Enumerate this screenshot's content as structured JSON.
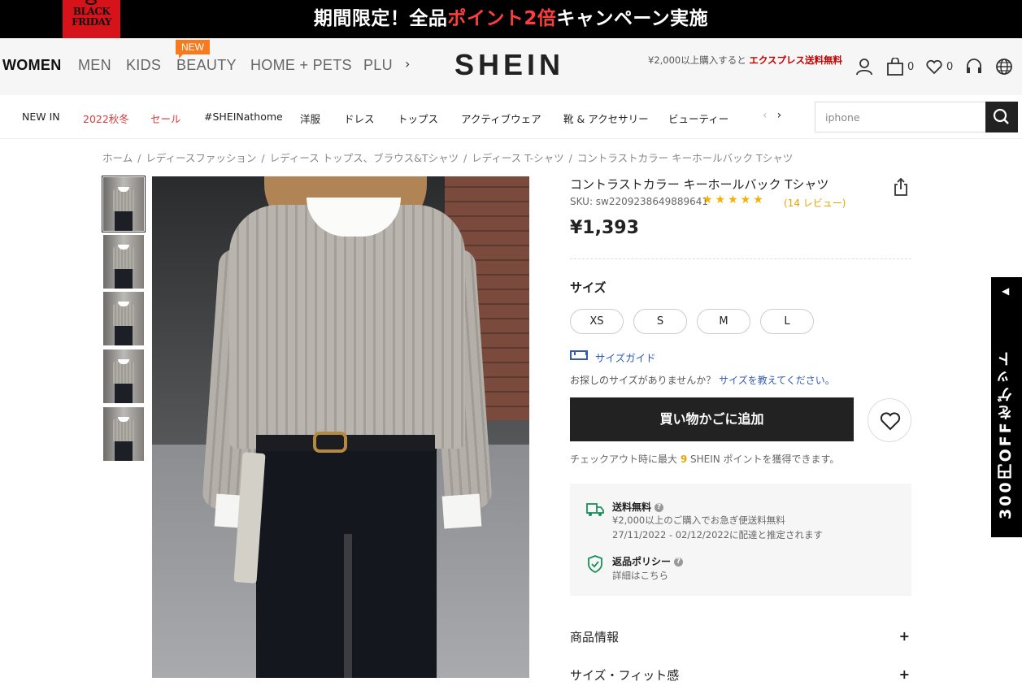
{
  "promo": {
    "badge_line1": "BLACK",
    "badge_line2": "FRIDAY",
    "text_before": "期間限定！全品",
    "text_highlight": "ポイント2倍",
    "text_after": "キャンペーン実施"
  },
  "header": {
    "categories": [
      "WOMEN",
      "MEN",
      "KIDS",
      "BEAUTY",
      "HOME + PETS",
      "PLU"
    ],
    "new_badge": "NEW",
    "logo": "SHEIN",
    "shipping_note_plain": "¥2,000以上購入すると ",
    "shipping_note_red": "エクスプレス送料無料",
    "bag_count": "0",
    "wishlist_count": "0"
  },
  "subnav": {
    "items": [
      "NEW IN",
      "2022秋冬",
      "セール",
      "#SHEINathome",
      "洋服",
      "ドレス",
      "トップス",
      "アクティブウェア",
      "靴 & アクセサリー",
      "ビューティー"
    ],
    "search_placeholder": "iphone"
  },
  "breadcrumb": [
    "ホーム",
    "レディースファッション",
    "レディース トップス、ブラウス&Tシャツ",
    "レディース T-シャツ",
    "コントラストカラー キーホールバック Tシャツ"
  ],
  "product": {
    "title": "コントラストカラー キーホールバック Tシャツ",
    "sku": "SKU: sw2209238649889641",
    "rating": 5,
    "reviews": "(14 レビュー)",
    "price": "¥1,393",
    "size_label": "サイズ",
    "sizes": [
      "XS",
      "S",
      "M",
      "L"
    ],
    "size_guide": "サイズガイド",
    "size_ask_plain": "お探しのサイズがありませんか？",
    "size_ask_link": "サイズを教えてください。",
    "add_to_cart": "買い物かごに追加",
    "points_before": "チェックアウト時に最大 ",
    "points_value": "9",
    "points_after": " SHEIN ポイントを獲得できます。"
  },
  "shipping": {
    "free_title": "送料無料",
    "free_line1": "¥2,000以上のご購入でお急ぎ便送料無料",
    "free_line2": "27/11/2022 - 02/12/2022に配達と推定されます",
    "return_title": "返品ポリシー",
    "return_line": "詳細はこちら"
  },
  "accordions": [
    "商品情報",
    "サイズ・フィット感"
  ],
  "side_tab": "300円OFFをゲット",
  "colors": {
    "accent_red": "#d63a3a",
    "promo_highlight": "#ff3d3d",
    "star": "#f6b100",
    "link_blue": "#2f5bb7",
    "primary_dark": "#222222"
  }
}
